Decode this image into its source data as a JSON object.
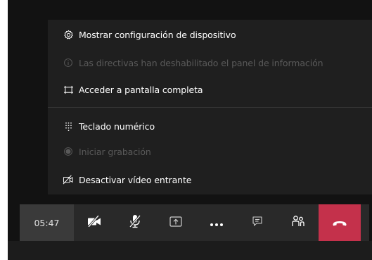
{
  "menu": {
    "items": [
      {
        "label": "Mostrar configuración de dispositivo",
        "icon": "gear-icon",
        "enabled": true
      },
      {
        "label": "Las directivas han deshabilitado el panel de información",
        "icon": "info-icon",
        "enabled": false
      },
      {
        "label": "Acceder a pantalla completa",
        "icon": "fullscreen-icon",
        "enabled": true
      },
      {
        "label": "Teclado numérico",
        "icon": "dialpad-icon",
        "enabled": true
      },
      {
        "label": "Iniciar grabación",
        "icon": "record-icon",
        "enabled": false
      },
      {
        "label": "Desactivar vídeo entrante",
        "icon": "video-off-icon",
        "enabled": true
      }
    ]
  },
  "call_bar": {
    "timer": "05:47",
    "buttons": [
      {
        "name": "camera-toggle",
        "icon": "camera-off-icon"
      },
      {
        "name": "mic-toggle",
        "icon": "mic-off-icon"
      },
      {
        "name": "share-screen",
        "icon": "share-screen-icon"
      },
      {
        "name": "more-actions",
        "icon": "more-icon"
      },
      {
        "name": "chat",
        "icon": "chat-icon"
      },
      {
        "name": "participants",
        "icon": "participants-icon"
      },
      {
        "name": "hang-up",
        "icon": "hang-up-icon"
      }
    ]
  },
  "colors": {
    "background": "#121212",
    "menu": "#1f1f1f",
    "bar": "#292929",
    "timer_bg": "#3a3a3a",
    "end_call": "#c4314b",
    "disabled_text": "#5a5a5a"
  }
}
